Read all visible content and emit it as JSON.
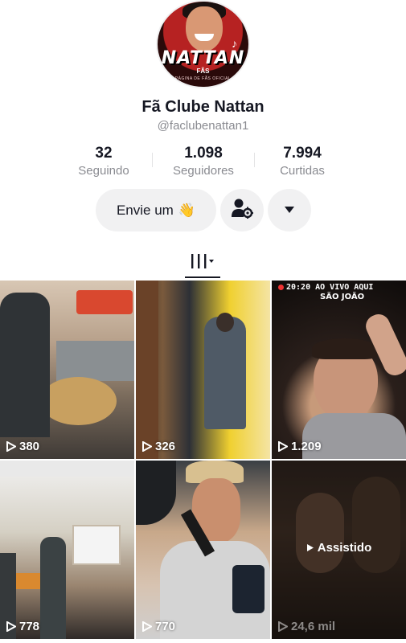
{
  "profile": {
    "name": "Fã Clube Nattan",
    "handle": "@faclubenattan1",
    "avatar": {
      "brand": "NATTAN",
      "brand_sub": "FÃS",
      "brand_tag": "PÁGINA DE FÃS OFICIAL"
    }
  },
  "stats": [
    {
      "value": "32",
      "label": "Seguindo"
    },
    {
      "value": "1.098",
      "label": "Seguidores"
    },
    {
      "value": "7.994",
      "label": "Curtidas"
    }
  ],
  "actions": {
    "message_label": "Envie um",
    "message_emoji": "👋",
    "friend_icon": "add-friend-gear-icon",
    "more_icon": "caret-down-icon"
  },
  "tabs": {
    "active": "videos-grid-tab"
  },
  "videos": [
    {
      "views": "380"
    },
    {
      "views": "326"
    },
    {
      "views": "1.209",
      "caption_top": "20:20 AO VIVO AQUI",
      "caption_sub": "SÃO JOÃO"
    },
    {
      "views": "778"
    },
    {
      "views": "770"
    },
    {
      "views": "24,6 mil",
      "status": "Assistido"
    }
  ],
  "colors": {
    "text": "#161823",
    "muted": "#8a8b91",
    "button_bg": "#f1f1f2",
    "avatar_red": "#b62222"
  }
}
